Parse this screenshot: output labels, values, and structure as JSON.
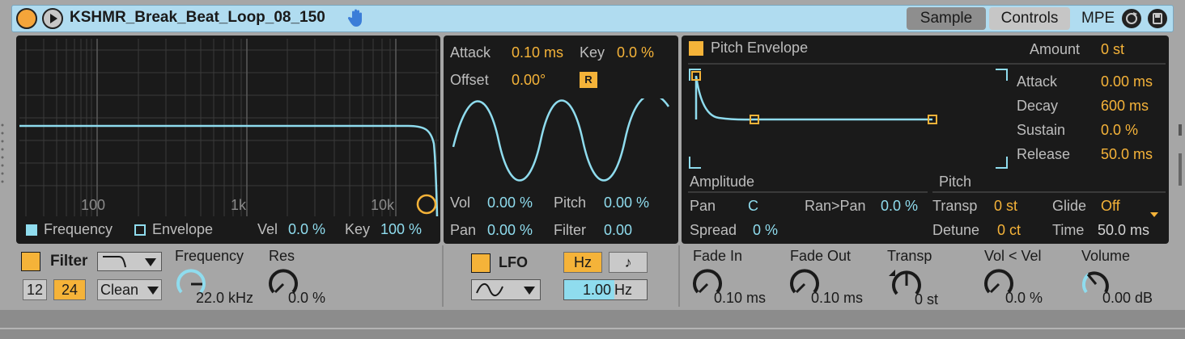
{
  "title_bar": {
    "clip_name": "KSHMR_Break_Beat_Loop_08_150",
    "tabs": [
      {
        "label": "Sample",
        "active": false
      },
      {
        "label": "Controls",
        "active": true
      }
    ],
    "mpe_label": "MPE"
  },
  "filter_display": {
    "ticks": [
      "100",
      "1k",
      "10k"
    ],
    "frequency_label": "Frequency",
    "envelope_label": "Envelope",
    "vel_label": "Vel",
    "vel_value": "0.0 %",
    "key_label": "Key",
    "key_value": "100 %"
  },
  "lfo_display": {
    "attack_label": "Attack",
    "attack_value": "0.10 ms",
    "key_label": "Key",
    "key_value": "0.0 %",
    "offset_label": "Offset",
    "offset_value": "0.00°",
    "r_label": "R",
    "vol_label": "Vol",
    "vol_value": "0.00 %",
    "pitch_label": "Pitch",
    "pitch_value": "0.00 %",
    "pan_label": "Pan",
    "pan_value": "0.00 %",
    "filter_label": "Filter",
    "filter_value": "0.00"
  },
  "pitch_envelope": {
    "title": "Pitch Envelope",
    "amount_label": "Amount",
    "amount_value": "0 st",
    "attack_label": "Attack",
    "attack_value": "0.00 ms",
    "decay_label": "Decay",
    "decay_value": "600 ms",
    "sustain_label": "Sustain",
    "sustain_value": "0.0 %",
    "release_label": "Release",
    "release_value": "50.0 ms"
  },
  "amplitude": {
    "title": "Amplitude",
    "pan_label": "Pan",
    "pan_value": "C",
    "ranpan_label": "Ran>Pan",
    "ranpan_value": "0.0 %",
    "spread_label": "Spread",
    "spread_value": "0 %"
  },
  "pitch": {
    "title": "Pitch",
    "transp_label": "Transp",
    "transp_value": "0 st",
    "glide_label": "Glide",
    "glide_value": "Off",
    "detune_label": "Detune",
    "detune_value": "0 ct",
    "time_label": "Time",
    "time_value": "50.0 ms"
  },
  "filter_controls": {
    "filter_label": "Filter",
    "slope_12": "12",
    "slope_24": "24",
    "circuit_value": "Clean",
    "frequency_label": "Frequency",
    "frequency_value": "22.0 kHz",
    "res_label": "Res",
    "res_value": "0.0 %"
  },
  "lfo_controls": {
    "lfo_label": "LFO",
    "hz_label": "Hz",
    "note_glyph": "♪",
    "rate_number": "1.00",
    "rate_unit": "Hz"
  },
  "bottom_knobs": {
    "fade_in_label": "Fade In",
    "fade_in_value": "0.10 ms",
    "fade_out_label": "Fade Out",
    "fade_out_value": "0.10 ms",
    "transp_label": "Transp",
    "transp_value": "0 st",
    "volvel_label": "Vol < Vel",
    "volvel_value": "0.0 %",
    "volume_label": "Volume",
    "volume_value": "0.00 dB"
  },
  "colors": {
    "accent_orange": "#f5b339",
    "accent_blue": "#8fdcee",
    "panel_bg": "#1a1a1a",
    "chrome_bg": "#a6a6a6"
  }
}
